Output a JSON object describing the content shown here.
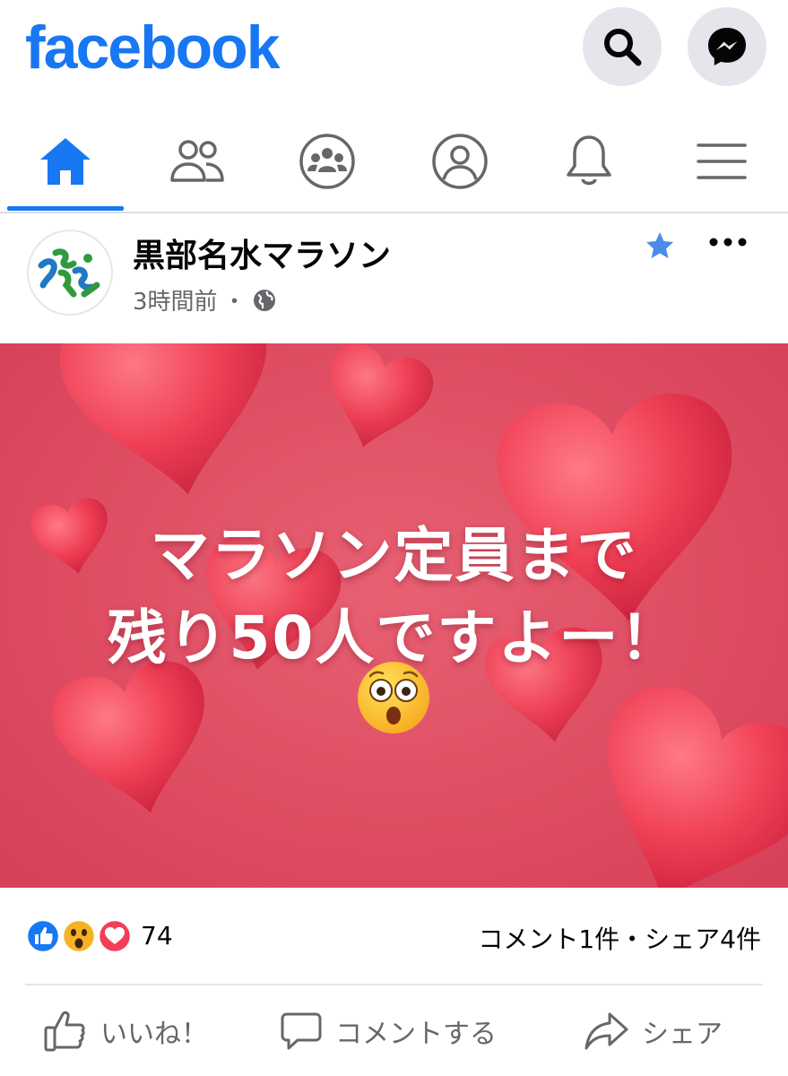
{
  "header": {
    "logo": "facebook",
    "search_icon": "search-icon",
    "messenger_icon": "messenger-icon"
  },
  "nav": {
    "tabs": [
      {
        "icon": "home-icon",
        "active": true
      },
      {
        "icon": "friends-icon",
        "active": false
      },
      {
        "icon": "groups-icon",
        "active": false
      },
      {
        "icon": "profile-icon",
        "active": false
      },
      {
        "icon": "bell-icon",
        "active": false
      },
      {
        "icon": "menu-icon",
        "active": false
      }
    ]
  },
  "post": {
    "author": "黒部名水マラソン",
    "time": "3時間前",
    "separator": "・",
    "privacy_icon": "globe-icon",
    "image": {
      "line1": "マラソン定員まで",
      "line2": "残り50人ですよー！",
      "emoji": "astonished-face-emoji"
    },
    "reactions": {
      "icons": [
        "like-reaction-icon",
        "wow-reaction-icon",
        "love-reaction-icon"
      ],
      "count": "74"
    },
    "stats": "コメント1件・シェア4件",
    "actions": {
      "like": "いいね！",
      "comment": "コメントする",
      "share": "シェア"
    }
  },
  "colors": {
    "brand": "#1877f2",
    "image_bg": "#df4d63",
    "secondary_text": "#65676b"
  }
}
